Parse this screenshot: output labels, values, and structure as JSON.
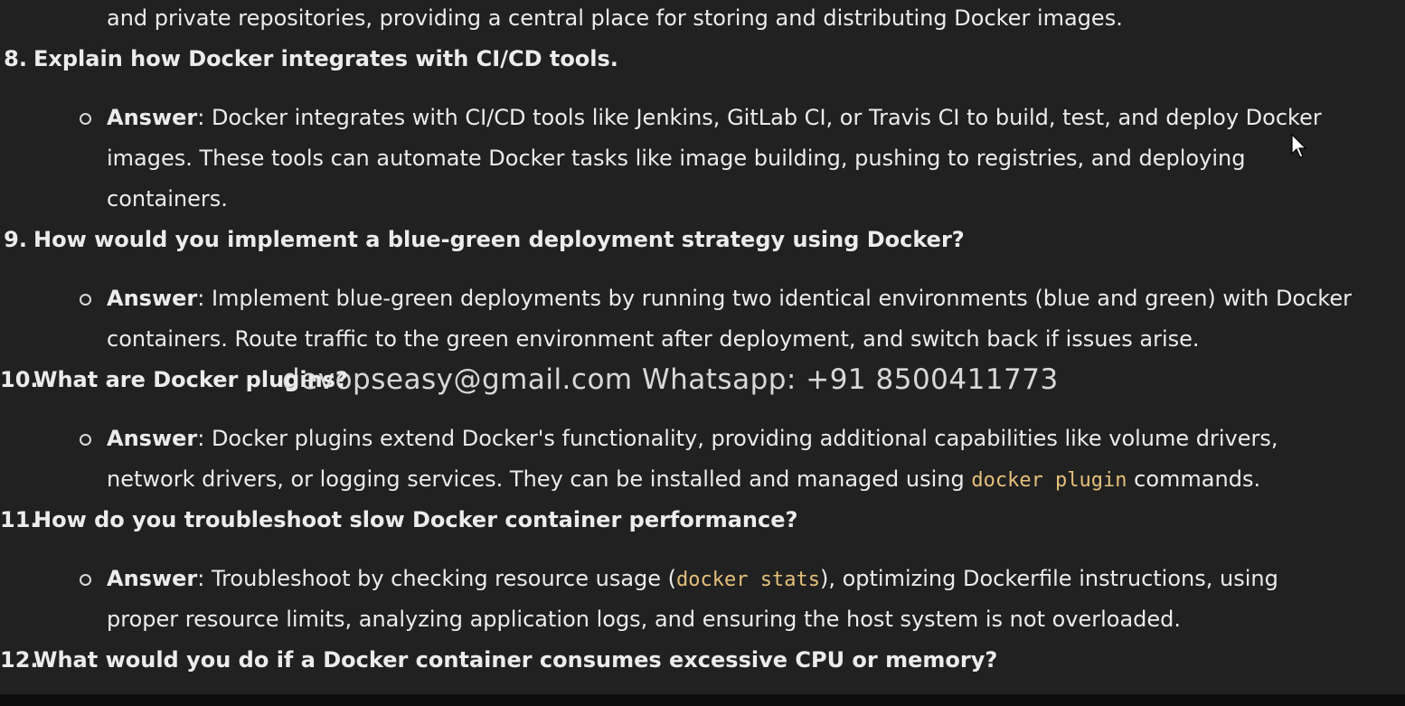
{
  "top_partial": "and private repositories, providing a central place for storing and distributing Docker images.",
  "answer_label": "Answer",
  "questions": [
    {
      "num": "8.",
      "text": "Explain how Docker integrates with CI/CD tools.",
      "answer_lines": [
        ": Docker integrates with CI/CD tools like Jenkins, GitLab CI, or Travis CI to build, test, and deploy Docker",
        "images. These tools can automate Docker tasks like image building, pushing to registries, and deploying",
        "containers."
      ]
    },
    {
      "num": "9.",
      "text": "How would you implement a blue-green deployment strategy using Docker?",
      "answer_lines": [
        ": Implement blue-green deployments by running two identical environments (blue and green) with Docker",
        "containers. Route traffic to the green environment after deployment, and switch back if issues arise."
      ]
    },
    {
      "num": "10.",
      "text": "What are Docker plugins?",
      "answer_lines": [
        ": Docker plugins extend Docker's functionality, providing additional capabilities like volume drivers,",
        "network drivers, or logging services. They can be installed and managed using "
      ],
      "code": "docker plugin",
      "after_code": " commands."
    },
    {
      "num": "11.",
      "text": "How do you troubleshoot slow Docker container performance?",
      "answer_pre": ": Troubleshoot by checking resource usage (",
      "code": "docker stats",
      "answer_post": "), optimizing Dockerfile instructions, using",
      "answer_line2": "proper resource limits, analyzing application logs, and ensuring the host system is not overloaded."
    },
    {
      "num": "12.",
      "text": "What would you do if a Docker container consumes excessive CPU or memory?"
    }
  ],
  "watermark": "devopseasy@gmail.com  Whatsapp: +91 8500411773",
  "colors": {
    "background": "#212121",
    "text": "#ececec",
    "code": "#e5c07b"
  }
}
